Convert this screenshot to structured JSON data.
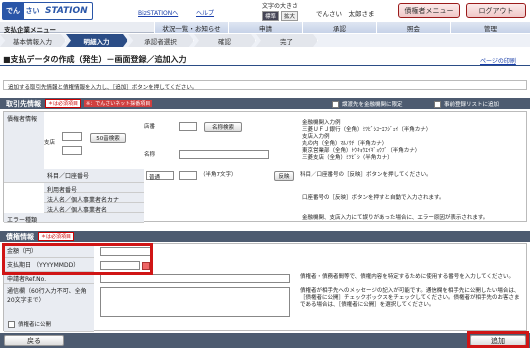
{
  "header": {
    "logo_chars": [
      "でん",
      "さい"
    ],
    "logo_station": "STATION",
    "bizstation_link": "BizSTATIONへ",
    "help_link": "ヘルプ",
    "fontsize_label": "文字の大きさ",
    "fontsize_std": "標準",
    "fontsize_large": "拡大",
    "user_name": "でんさい　太郎さま",
    "menu_button": "債権者メニュー",
    "logout_button": "ログアウト"
  },
  "nav": {
    "area_title": "支払企業メニュー",
    "items": [
      "状況一覧・お知らせ",
      "申請",
      "承認",
      "照会",
      "管理"
    ]
  },
  "steps": [
    "基本情報入力",
    "明細入力",
    "承認者選択",
    "確認",
    "完了"
  ],
  "page": {
    "title": "■支払データの作成（発生）－画面登録／追加入力",
    "print_link": "ページの印刷",
    "note": "追加する取引先情報と債権情報を入力し、［追加］ボタンを押してください。"
  },
  "payee": {
    "header": "取引先情報",
    "req_tag": "＊は必須項目",
    "net_tag": "※：でんさいネット採番項目",
    "chk_same": "譲渡先を金融機関に限定",
    "chk_add": "事前登録リストに追加",
    "creditor_info": "債権者情報",
    "branch_label": "支店",
    "bank_search": "50音検索",
    "branch_name_label": "店番",
    "name_search": "名称検索",
    "name_label": "名称",
    "account_label": "科目／口座番号",
    "account_type": "普通",
    "half_width": "（半角7文字）",
    "reverse_btn": "反映",
    "reverse_text": "科目／口座番号の［反映］ボタンを押してください。",
    "bank_code_text": [
      "金融機関入力例",
      "三菱ＵＦＪ銀行（全角）ﾐﾂﾋﾞｼﾕｰｴﾌｼﾞｪｲ（半角カナ）",
      "支店入力例",
      "丸の内（全角）ﾏﾙﾉｳﾁ（半角カナ）",
      "東京営業部（全角）ﾄｳｷｮｳｴｲｷﾞｮｳﾌﾞ（半角カナ）",
      "三菱支店（全角）ﾐﾂﾋﾞｼ（半角カナ）"
    ],
    "user_num": "利用者番号",
    "corp_name_kana": "法人名／個人事業者名カナ",
    "corp_name": "法人名／個人事業者名",
    "error_label": "エラー種類",
    "auto_note": "口座番号の［反映］ボタンを押すと自動で入力されます。",
    "error_note": "金融機関、支店入力にて誤りがあった場合に、エラー原因が表示されます。"
  },
  "bond": {
    "header": "債権情報",
    "req_tag": "＊は必須項目",
    "amount_label": "金額（円）",
    "due_label": "支払期日",
    "due_hint": "（YYYYMMDD）",
    "ref_label": "申請者Ref.No.",
    "memo_label": "通信欄（60行入力不可、全角20文字まで）",
    "chk_public": "債権者に公開",
    "ref_note": "債権者・債務者間等で、債権内容を特定するために使用する番号を入力してください。",
    "memo_note": "債権者が相手先へのメッセージの記入が可能です。通信欄を相手先に公開したい場合は、［債権者に公開］チェックボックスをチェックしてください。債権者が相手先のお客さまである場合は、［債権者に公開］を選択してください。"
  },
  "footer": {
    "back": "戻る",
    "add": "追加"
  }
}
